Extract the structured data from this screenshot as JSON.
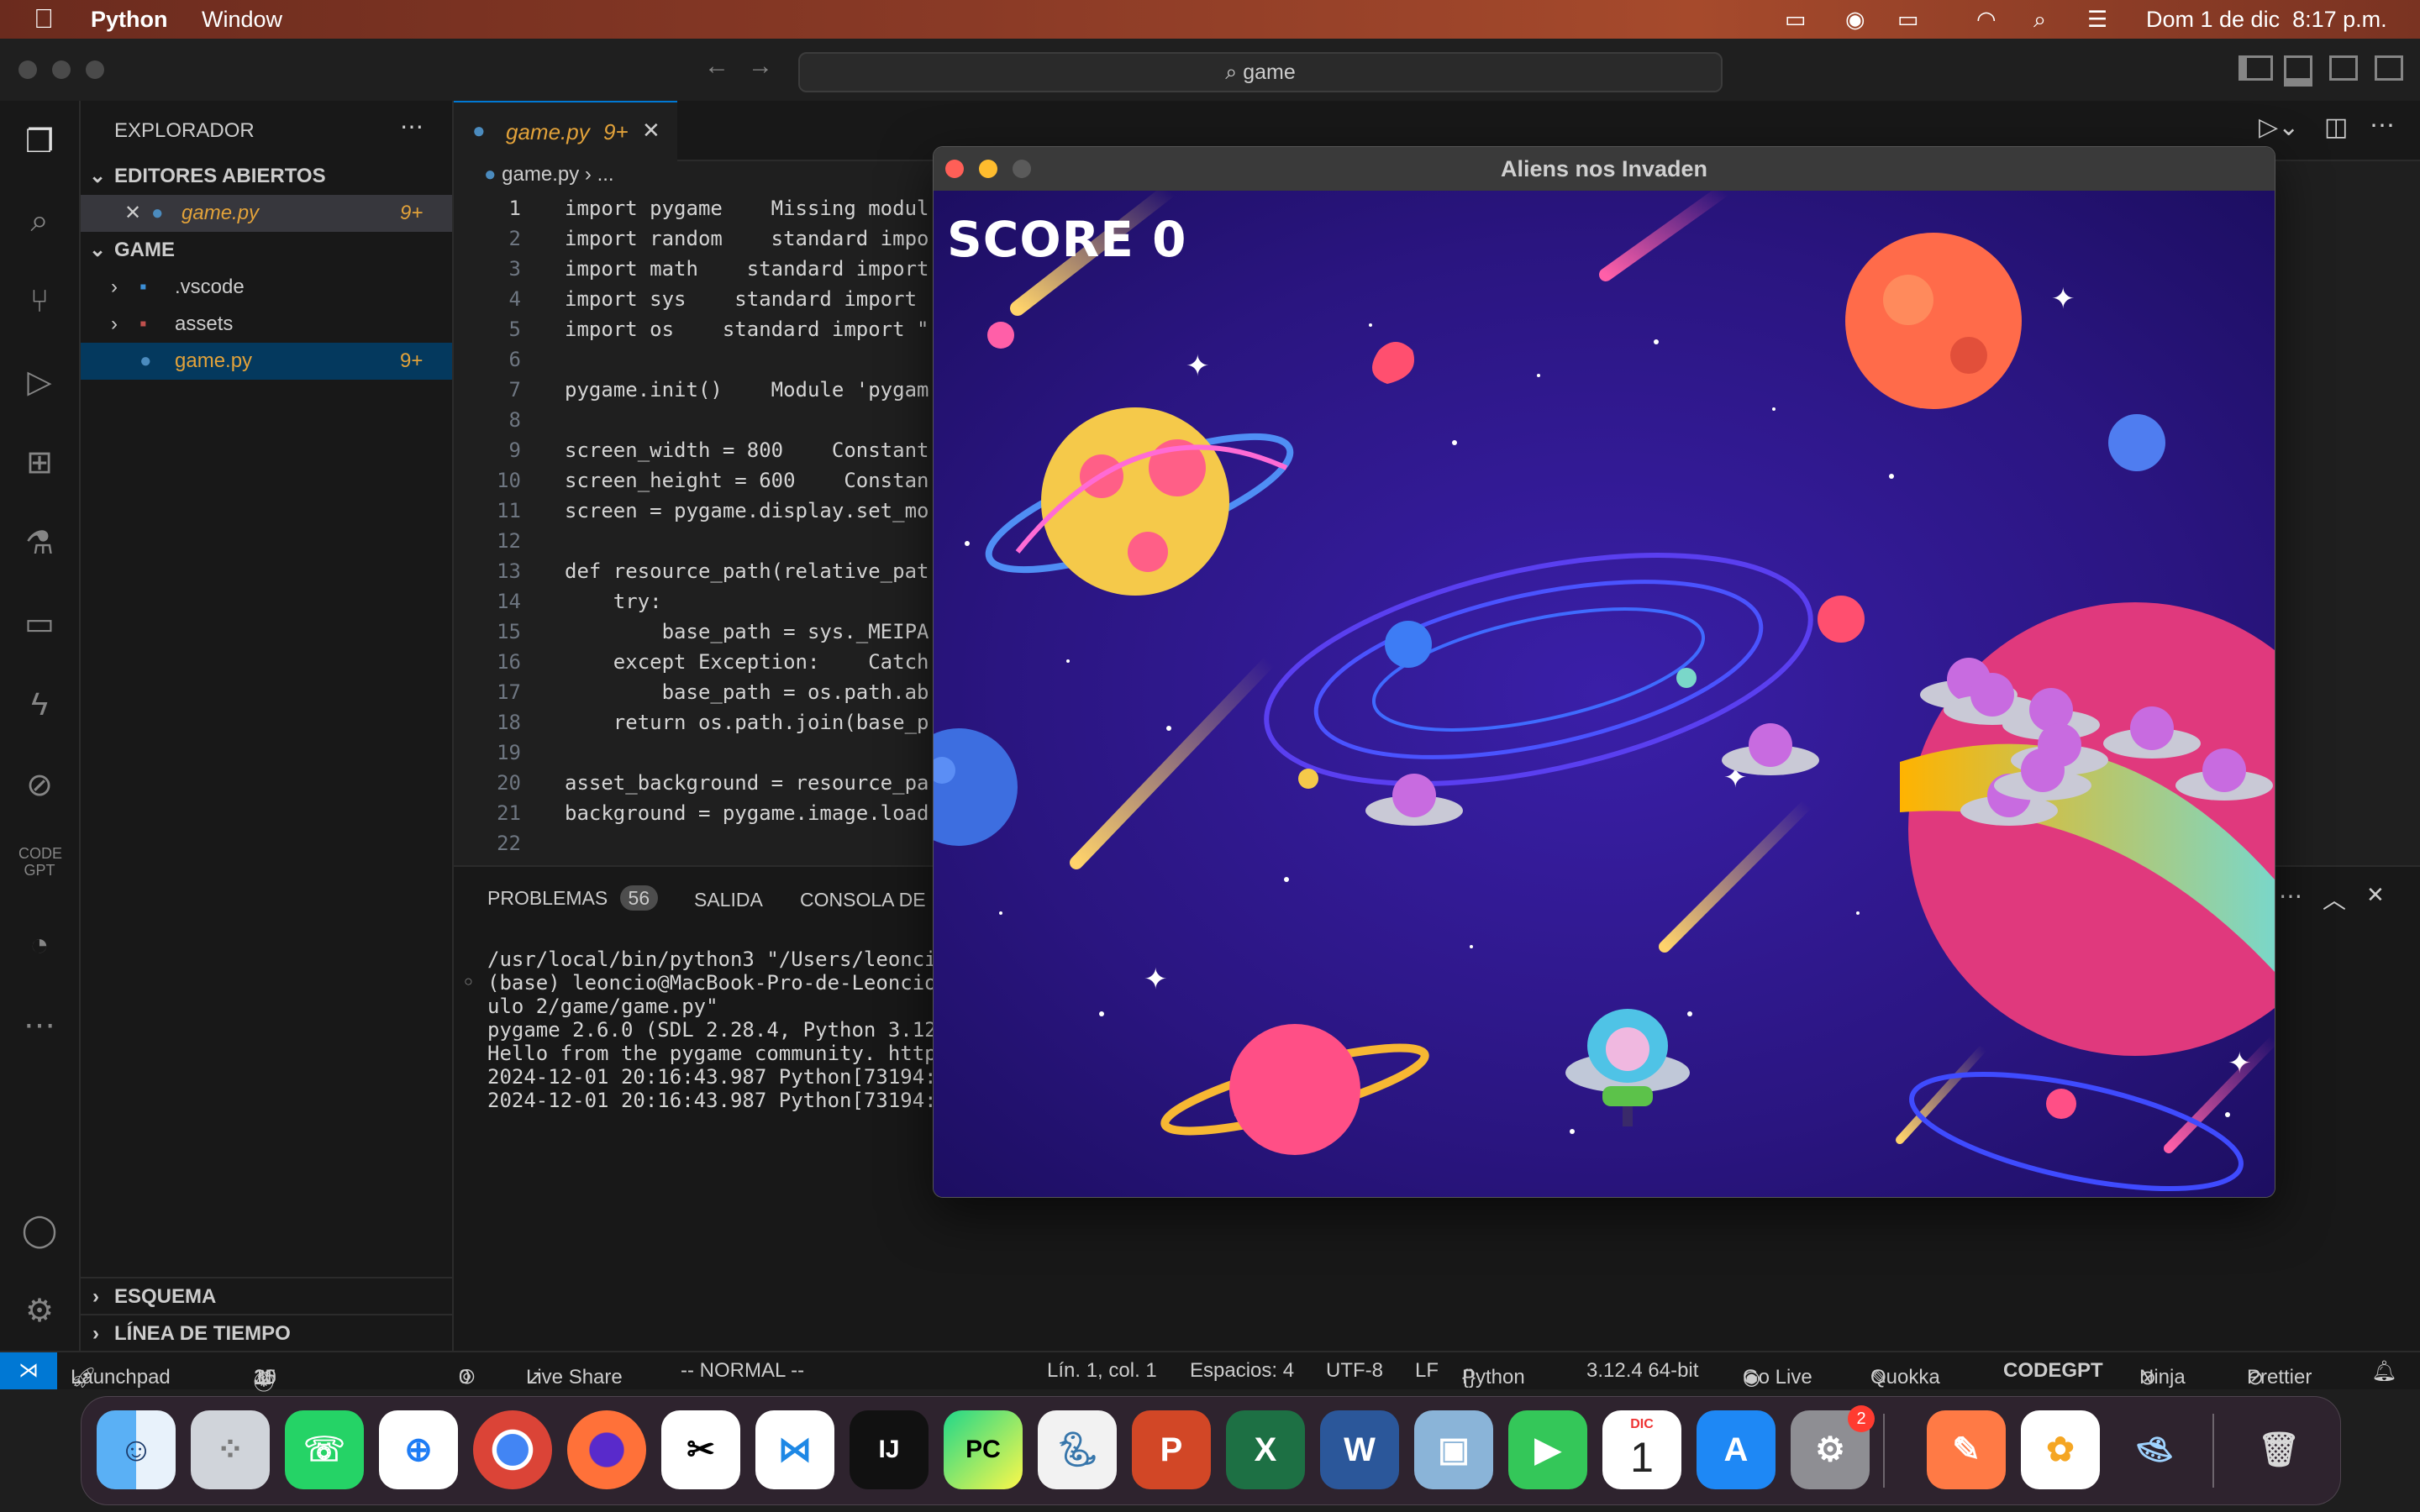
{
  "menubar": {
    "app_name": "Python",
    "window_menu": "Window",
    "datetime": "Dom 1 de dic  8:17 p.m."
  },
  "titlebar": {
    "search_text": "game"
  },
  "sidebar": {
    "title": "EXPLORADOR",
    "open_editors_label": "EDITORES ABIERTOS",
    "open_file": {
      "name": "game.py",
      "badge": "9+"
    },
    "folder_label": "GAME",
    "items": [
      {
        "name": ".vscode"
      },
      {
        "name": "assets"
      },
      {
        "name": "game.py",
        "badge": "9+"
      }
    ],
    "outline_label": "ESQUEMA",
    "timeline_label": "LÍNEA DE TIEMPO"
  },
  "editor": {
    "tab_label": "game.py",
    "tab_badge": "9+",
    "breadcrumb_file": "game.py",
    "breadcrumb_rest": "...",
    "lines": [
      {
        "n": "1",
        "text": "import pygame    Missing modul"
      },
      {
        "n": "2",
        "text": "import random    standard impo"
      },
      {
        "n": "3",
        "text": "import math    standard import"
      },
      {
        "n": "4",
        "text": "import sys    standard import"
      },
      {
        "n": "5",
        "text": "import os    standard import \""
      },
      {
        "n": "6",
        "text": ""
      },
      {
        "n": "7",
        "text": "pygame.init()    Module 'pygam"
      },
      {
        "n": "8",
        "text": ""
      },
      {
        "n": "9",
        "text": "screen_width = 800    Constant"
      },
      {
        "n": "10",
        "text": "screen_height = 600    Constan"
      },
      {
        "n": "11",
        "text": "screen = pygame.display.set_mo"
      },
      {
        "n": "12",
        "text": ""
      },
      {
        "n": "13",
        "text": "def resource_path(relative_pat"
      },
      {
        "n": "14",
        "text": "    try:"
      },
      {
        "n": "15",
        "text": "        base_path = sys._MEIPA"
      },
      {
        "n": "16",
        "text": "    except Exception:    Catch"
      },
      {
        "n": "17",
        "text": "        base_path = os.path.ab"
      },
      {
        "n": "18",
        "text": "    return os.path.join(base_p"
      },
      {
        "n": "19",
        "text": ""
      },
      {
        "n": "20",
        "text": "asset_background = resource_pa"
      },
      {
        "n": "21",
        "text": "background = pygame.image.load"
      },
      {
        "n": "22",
        "text": ""
      }
    ]
  },
  "panel": {
    "tab_problems": "PROBLEMAS",
    "problems_count": "56",
    "tab_output": "SALIDA",
    "tab_console": "CONSOLA DE I",
    "terminal_lines": [
      "/usr/local/bin/python3 \"/Users/leoncic",
      "(base) leoncio@MacBook-Pro-de-Leoncio",
      "ulo 2/game/game.py\"",
      "pygame 2.6.0 (SDL 2.28.4, Python 3.12.",
      "Hello from the pygame community. https",
      "2024-12-01 20:16:43.987 Python[73194:4",
      "2024-12-01 20:16:43.987 Python[73194:4"
    ]
  },
  "game": {
    "window_title": "Aliens nos Invaden",
    "score_label": "SCORE 0"
  },
  "statusbar": {
    "launchpad": "Launchpad",
    "errors": "11",
    "warnings": "15",
    "infos": "30",
    "ports": "0",
    "live_share": "Live Share",
    "mode": "-- NORMAL --",
    "position": "Lín. 1, col. 1",
    "spaces": "Espacios: 4",
    "encoding": "UTF-8",
    "eol": "LF",
    "language": "Python",
    "interpreter": "3.12.4 64-bit",
    "go_live": "Go Live",
    "quokka": "Quokka",
    "codegpt": "CODEGPT",
    "ninja": "Ninja",
    "prettier": "Prettier"
  },
  "dock": {
    "calendar_month": "DIC",
    "calendar_day": "1",
    "settings_badge": "2",
    "apps": [
      "finder-icon",
      "launchpad-icon",
      "whatsapp-icon",
      "safari-icon",
      "chrome-icon",
      "firefox-icon",
      "capcut-icon",
      "vscode-icon",
      "intellij-icon",
      "pycharm-icon",
      "python-launcher-icon",
      "powerpoint-icon",
      "excel-icon",
      "word-icon",
      "preview-icon",
      "facetime-icon",
      "calendar-icon",
      "appstore-icon",
      "settings-icon",
      "pen-icon",
      "photos-icon",
      "ufo-game-icon",
      "trash-icon"
    ]
  }
}
